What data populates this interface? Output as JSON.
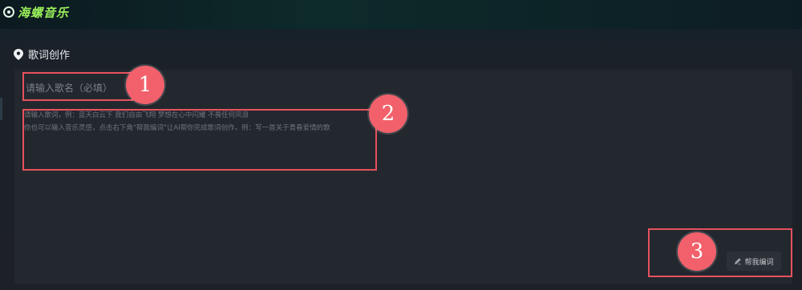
{
  "app": {
    "logo_text": "海螺音乐"
  },
  "section": {
    "title": "歌词创作"
  },
  "form": {
    "song_name_placeholder": "请输入歌名（必填）",
    "lyrics_placeholder": "请输入歌词，例：蓝天白云下 我们自由飞翔 梦想在心中闪耀 不畏任何风浪\n你也可以输入音乐灵感，点击右下角\"帮我编词\"让AI帮你完成歌词创作，例：写一首关于青春爱情的歌",
    "help_button_label": "帮我编词"
  },
  "annotations": [
    {
      "number": "1"
    },
    {
      "number": "2"
    },
    {
      "number": "3"
    }
  ],
  "colors": {
    "accent_logo": "#9bf05a",
    "annotation": "#e7515e",
    "badge": "#f2616b"
  }
}
